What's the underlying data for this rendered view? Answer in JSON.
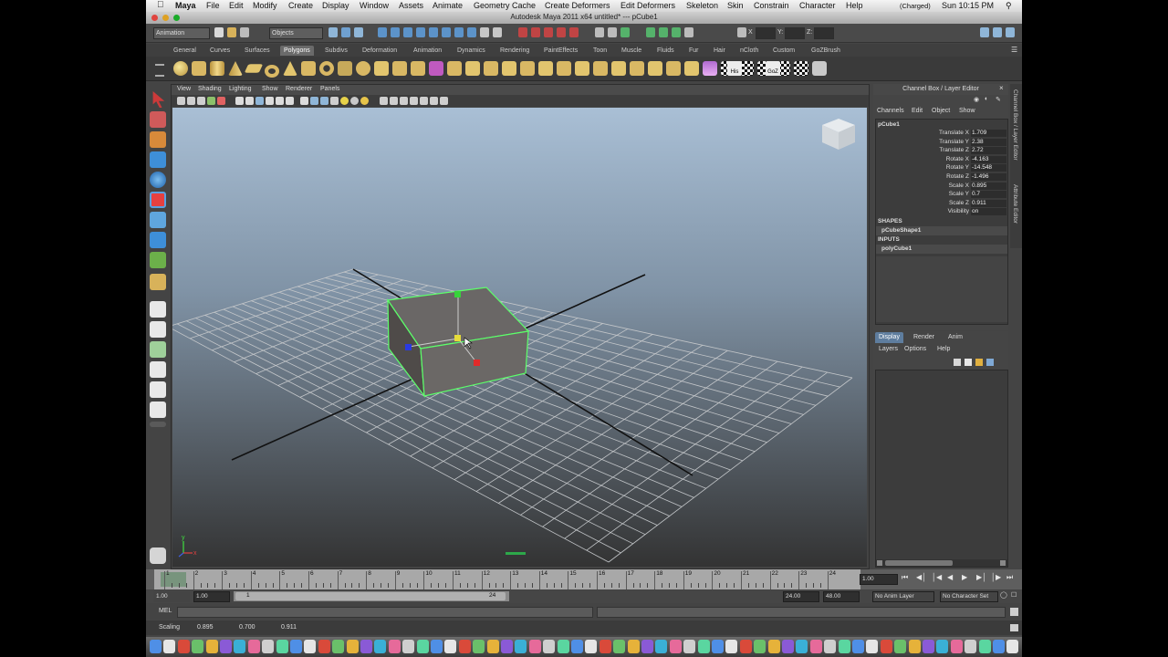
{
  "menubar": {
    "app": "Maya",
    "items": [
      "File",
      "Edit",
      "Modify",
      "Create",
      "Display",
      "Window",
      "Assets",
      "Animate",
      "Geometry Cache",
      "Create Deformers",
      "Edit Deformers",
      "Skeleton",
      "Skin",
      "Constrain",
      "Character",
      "Help"
    ],
    "battery": "(Charged)",
    "clock": "Sun 10:15 PM"
  },
  "window": {
    "title": "Autodesk Maya 2011 x64  untitled*   ---   pCube1"
  },
  "statusline": {
    "mode": "Animation",
    "selection_mode": "Objects",
    "x_label": "X",
    "y_label": "Y:",
    "z_label": "Z:"
  },
  "shelf": {
    "tabs": [
      "General",
      "Curves",
      "Surfaces",
      "Polygons",
      "Subdivs",
      "Deformation",
      "Animation",
      "Dynamics",
      "Rendering",
      "PaintEffects",
      "Toon",
      "Muscle",
      "Fluids",
      "Fur",
      "Hair",
      "nCloth",
      "Custom",
      "GoZBrush"
    ],
    "active_tab": "Polygons",
    "icon_labels": {
      "his": "His",
      "goz": "GoZ"
    }
  },
  "panel": {
    "menu": [
      "View",
      "Shading",
      "Lighting",
      "Show",
      "Renderer",
      "Panels"
    ]
  },
  "viewport": {
    "axis_y": "y",
    "axis_x": "x",
    "axis_z": "z"
  },
  "channelbox": {
    "header": "Channel Box / Layer Editor",
    "menu": [
      "Channels",
      "Edit",
      "Object",
      "Show"
    ],
    "object": "pCube1",
    "channels": [
      {
        "name": "Translate X",
        "value": "1.709"
      },
      {
        "name": "Translate Y",
        "value": "2.38"
      },
      {
        "name": "Translate Z",
        "value": "2.72"
      },
      {
        "name": "Rotate X",
        "value": "-4.163"
      },
      {
        "name": "Rotate Y",
        "value": "-14.548"
      },
      {
        "name": "Rotate Z",
        "value": "-1.496"
      },
      {
        "name": "Scale X",
        "value": "0.895"
      },
      {
        "name": "Scale Y",
        "value": "0.7"
      },
      {
        "name": "Scale Z",
        "value": "0.911"
      },
      {
        "name": "Visibility",
        "value": "on"
      }
    ],
    "shapes_label": "SHAPES",
    "shape": "pCubeShape1",
    "inputs_label": "INPUTS",
    "input": "polyCube1",
    "side_tabs": [
      "Channel Box / Layer Editor",
      "Attribute Editor"
    ]
  },
  "layereditor": {
    "tabs": [
      "Display",
      "Render",
      "Anim"
    ],
    "active_tab": "Display",
    "menu": [
      "Layers",
      "Options",
      "Help"
    ]
  },
  "timeline": {
    "ticks": [
      "1",
      "2",
      "3",
      "4",
      "5",
      "6",
      "7",
      "8",
      "9",
      "10",
      "11",
      "12",
      "13",
      "14",
      "15",
      "16",
      "17",
      "18",
      "19",
      "20",
      "21",
      "22",
      "23",
      "24"
    ],
    "current": "1.00"
  },
  "range": {
    "start": "1.00",
    "inner_start": "1.00",
    "slider_start": "1",
    "slider_end": "24",
    "end": "24.00",
    "outer_end": "48.00",
    "anim_layer": "No Anim Layer",
    "char_set": "No Character Set"
  },
  "mel": {
    "label": "MEL"
  },
  "helpline": {
    "tool": "Scaling",
    "v1": "0.895",
    "v2": "0.700",
    "v3": "0.911"
  },
  "colors": {
    "accent": "#5e7d9e",
    "selection": "#5cff6a",
    "viewport_top": "#a8bdd3",
    "viewport_bottom": "#343434"
  }
}
